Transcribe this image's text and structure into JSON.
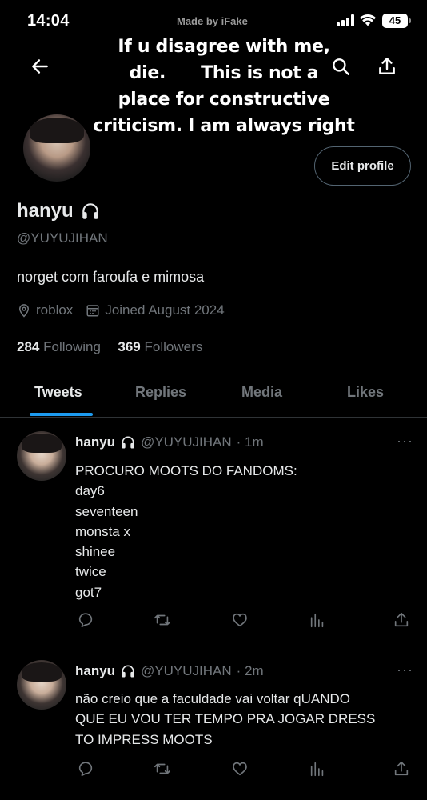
{
  "status_bar": {
    "time": "14:04",
    "watermark": "Made by iFake",
    "battery": "45"
  },
  "overlay_text": {
    "lines": [
      "If u disagree with me,",
      "die.      This is not a",
      "place for constructive",
      "criticism. I am always right"
    ]
  },
  "header": {
    "back_icon": "arrow-left-icon",
    "search_icon": "search-icon",
    "share_icon": "share-icon"
  },
  "profile": {
    "name": "hanyu",
    "name_emoji_icon": "headphones-icon",
    "handle": "@YUYUJIHAN",
    "edit_label": "Edit profile",
    "bio": "norget com faroufa e mimosa",
    "location": "roblox",
    "joined": "Joined August 2024",
    "following_count": "284",
    "following_label": "Following",
    "followers_count": "369",
    "followers_label": "Followers"
  },
  "tabs": [
    {
      "label": "Tweets",
      "active": true
    },
    {
      "label": "Replies",
      "active": false
    },
    {
      "label": "Media",
      "active": false
    },
    {
      "label": "Likes",
      "active": false
    }
  ],
  "tweets": [
    {
      "name": "hanyu",
      "handle": "@YUYUJIHAN",
      "time": "· 1m",
      "more": "···",
      "lines": [
        "PROCURO MOOTS DO FANDOMS:",
        "day6",
        "seventeen",
        "monsta x",
        "shinee",
        "twice",
        "got7"
      ]
    },
    {
      "name": "hanyu",
      "handle": "@YUYUJIHAN",
      "time": "· 2m",
      "more": "···",
      "lines": [
        "não creio que a faculdade vai voltar qUANDO",
        "QUE EU VOU TER TEMPO PRA JOGAR DRESS",
        "TO IMPRESS MOOTS"
      ]
    }
  ],
  "colors": {
    "accent": "#1d9bf0",
    "background": "#000000",
    "text_primary": "#e7e9ea",
    "text_secondary": "#71767b",
    "divider": "#2f3336"
  }
}
